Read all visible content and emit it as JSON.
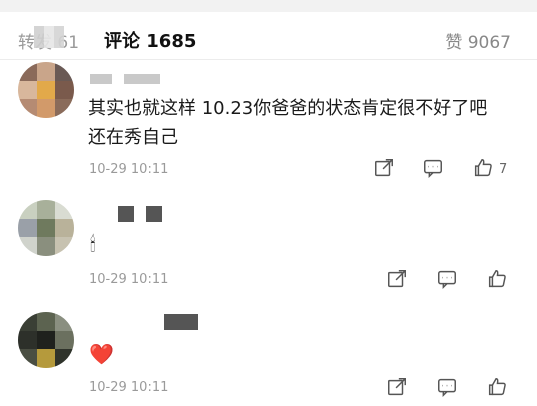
{
  "header": {
    "tab_left": "转发 61",
    "tab_active": "评论 1685",
    "tab_right": "赞 9067"
  },
  "comments": [
    {
      "text_line1": "其实也就这样 10.23你爸爸的状态肯定很不好了吧",
      "text_line2": "还在秀自己",
      "time": "10-29 10:11",
      "like_count": "7"
    },
    {
      "emoji": "🕯",
      "time": "10-29 10:11",
      "like_count": ""
    },
    {
      "emoji": "❤️",
      "time": "10-29 10:11",
      "like_count": ""
    }
  ],
  "icons": [
    "share-icon",
    "reply-icon",
    "like-icon"
  ]
}
